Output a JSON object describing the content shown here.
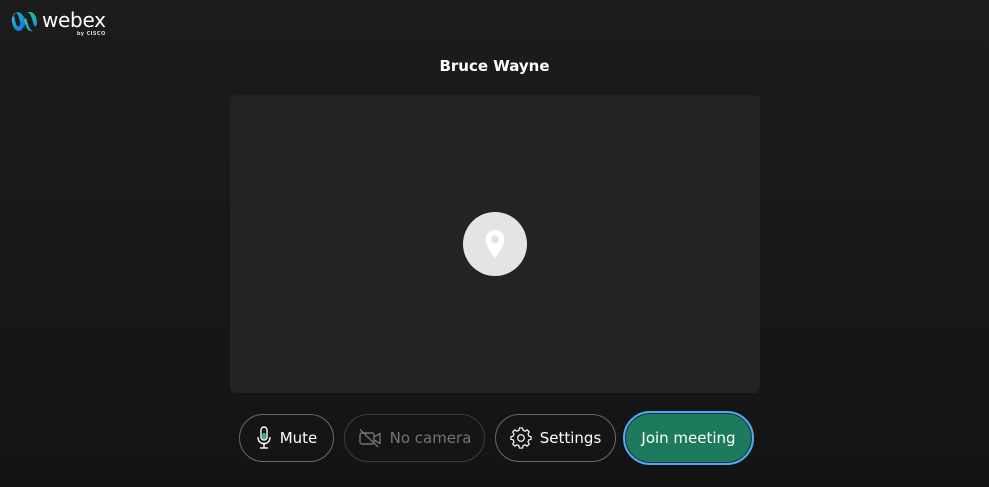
{
  "logo": {
    "wordmark": "webex",
    "byline": "by CISCO",
    "icon": "webex-logo-icon"
  },
  "user": {
    "name": "Bruce Wayne",
    "avatar_icon": "location-pin-icon"
  },
  "controls": {
    "mute_label": "Mute",
    "mute_icon": "microphone-icon",
    "camera_label": "No camera",
    "camera_icon": "camera-off-icon",
    "settings_label": "Settings",
    "settings_icon": "gear-icon",
    "join_label": "Join meeting"
  },
  "colors": {
    "background": "#161616",
    "preview": "#232323",
    "join_button": "#1d7a5d",
    "join_border": "#5aa7ee",
    "mic_level": "#2fc07a"
  }
}
